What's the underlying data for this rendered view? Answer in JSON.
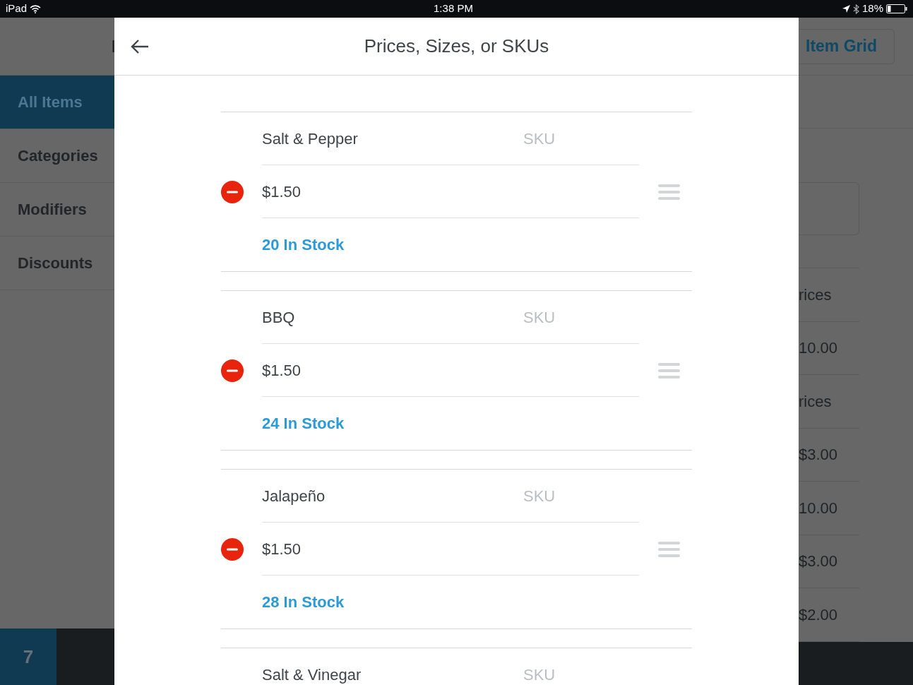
{
  "status_bar": {
    "device": "iPad",
    "time": "1:38 PM",
    "battery": "18%"
  },
  "background": {
    "header_fragment": "I",
    "sidebar": [
      {
        "label": "All Items",
        "selected": true
      },
      {
        "label": "Categories",
        "selected": false
      },
      {
        "label": "Modifiers",
        "selected": false
      },
      {
        "label": "Discounts",
        "selected": false
      }
    ],
    "footer_count": "7",
    "grid_button": "Item Grid",
    "rows": [
      "rices",
      "10.00",
      "rices",
      "$3.00",
      "10.00",
      "$3.00",
      "$2.00"
    ]
  },
  "dialog": {
    "title": "Prices, Sizes, or SKUs",
    "variations": [
      {
        "name": "Salt & Pepper",
        "sku_placeholder": "SKU",
        "price": "$1.50",
        "stock": "20 In Stock"
      },
      {
        "name": "BBQ",
        "sku_placeholder": "SKU",
        "price": "$1.50",
        "stock": "24 In Stock"
      },
      {
        "name": "Jalapeño",
        "sku_placeholder": "SKU",
        "price": "$1.50",
        "stock": "28 In Stock"
      },
      {
        "name": "Salt & Vinegar",
        "sku_placeholder": "SKU"
      }
    ]
  }
}
